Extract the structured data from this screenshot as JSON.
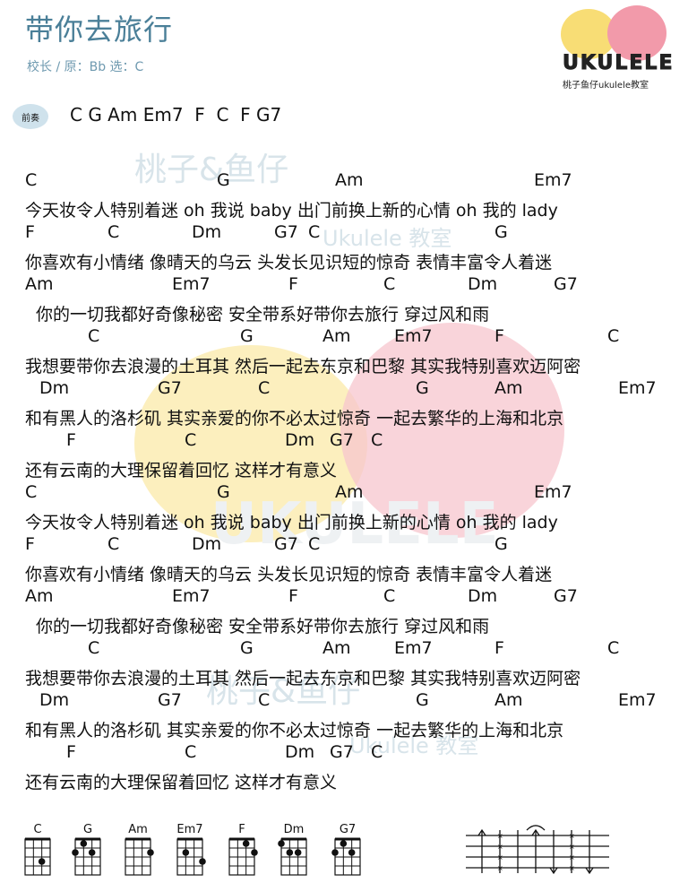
{
  "title": "带你去旅行",
  "meta": "校长 / 原：Bb 选：C",
  "logo": {
    "wordmark": "UKULELE",
    "subtitle": "桃子鱼仔ukulele教室"
  },
  "intro": {
    "badge": "前奏",
    "chords": "C G Am Em7  F  C  F G7"
  },
  "watermarks": [
    "桃子&鱼仔",
    "Ukulele 教室",
    "UKULELE",
    "桃子&鱼仔",
    "Ukulele 教室"
  ],
  "lines": [
    {
      "chords": [
        "C",
        "G",
        "Am",
        "Em7"
      ],
      "lyric": "今天妆令人特别着迷  oh 我说 baby  出门前换上新的心情  oh 我的 lady"
    },
    {
      "chords": [
        "F",
        "C",
        "Dm",
        "G7",
        "C",
        "G"
      ],
      "lyric": "你喜欢有小情绪  像晴天的乌云  头发长见识短的惊奇  表情丰富令人着迷"
    },
    {
      "chords": [
        "Am",
        "Em7",
        "F",
        "C",
        "Dm",
        "G7"
      ],
      "lyric": "你的一切我都好奇像秘密  安全带系好带你去旅行  穿过风和雨"
    },
    {
      "chords": [
        "C",
        "G",
        "Am",
        "Em7",
        "F",
        "C"
      ],
      "lyric": "我想要带你去浪漫的土耳其 然后一起去东京和巴黎  其实我特别喜欢迈阿密"
    },
    {
      "chords": [
        "Dm",
        "G7",
        "C",
        "G",
        "Am",
        "Em7"
      ],
      "lyric": "和有黑人的洛杉矶  其实亲爱的你不必太过惊奇  一起去繁华的上海和北京"
    },
    {
      "chords": [
        "F",
        "C",
        "Dm",
        "G7",
        "C"
      ],
      "lyric": "还有云南的大理保留着回忆  这样才有意义"
    },
    {
      "chords": [
        "C",
        "G",
        "Am",
        "Em7"
      ],
      "lyric": "今天妆令人特别着迷  oh 我说 baby  出门前换上新的心情  oh 我的 lady"
    },
    {
      "chords": [
        "F",
        "C",
        "Dm",
        "G7",
        "C",
        "G"
      ],
      "lyric": "你喜欢有小情绪  像晴天的乌云  头发长见识短的惊奇  表情丰富令人着迷"
    },
    {
      "chords": [
        "Am",
        "Em7",
        "F",
        "C",
        "Dm",
        "G7"
      ],
      "lyric": "你的一切我都好奇像秘密  安全带系好带你去旅行  穿过风和雨"
    },
    {
      "chords": [
        "C",
        "G",
        "Am",
        "Em7",
        "F",
        "C"
      ],
      "lyric": "我想要带你去浪漫的土耳其 然后一起去东京和巴黎  其实我特别喜欢迈阿密"
    },
    {
      "chords": [
        "Dm",
        "G7",
        "C",
        "G",
        "Am",
        "Em7"
      ],
      "lyric": "和有黑人的洛杉矶  其实亲爱的你不必太过惊奇  一起去繁华的上海和北京"
    },
    {
      "chords": [
        "F",
        "C",
        "Dm",
        "G7",
        "C"
      ],
      "lyric": "还有云南的大理保留着回忆  这样才有意义"
    }
  ],
  "chord_diagrams": [
    "C",
    "G",
    "Am",
    "Em7",
    "F",
    "Dm",
    "G7"
  ]
}
